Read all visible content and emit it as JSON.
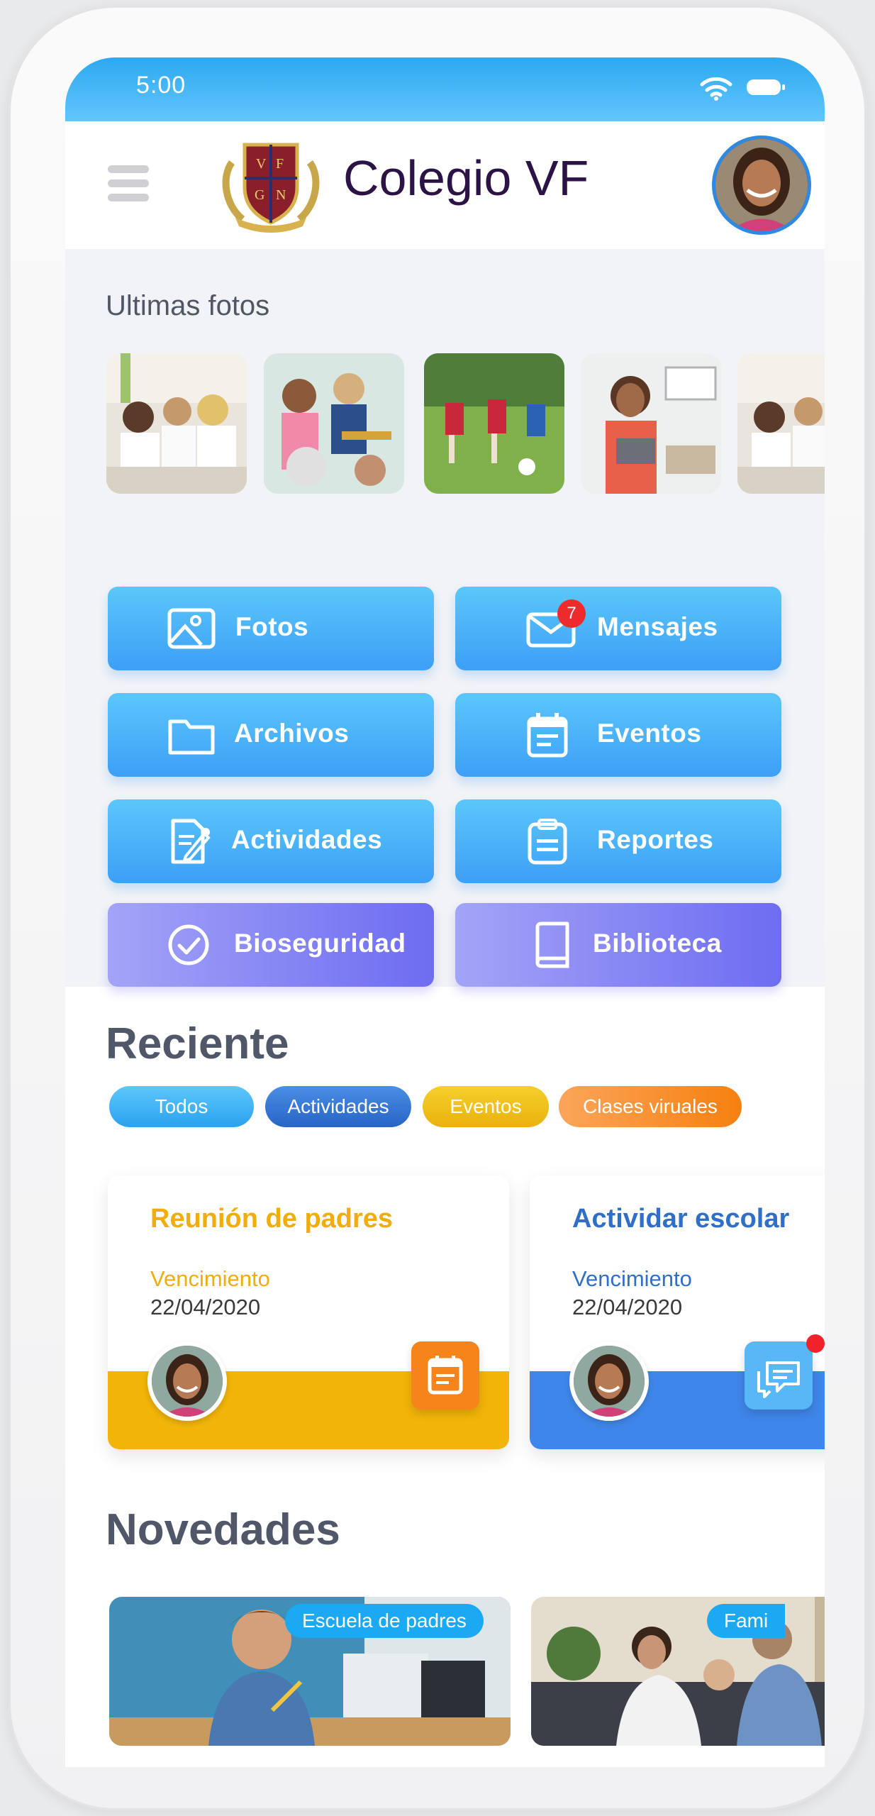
{
  "status_bar": {
    "time": "5:00"
  },
  "header": {
    "title": "Colegio VF",
    "crest_letters": [
      "V",
      "F",
      "G",
      "N"
    ]
  },
  "photos": {
    "title": "Ultimas fotos"
  },
  "tiles": [
    {
      "label": "Fotos",
      "icon": "image-icon"
    },
    {
      "label": "Mensajes",
      "icon": "mail-icon",
      "badge": "7"
    },
    {
      "label": "Archivos",
      "icon": "folder-icon"
    },
    {
      "label": "Eventos",
      "icon": "calendar-icon"
    },
    {
      "label": "Actividades",
      "icon": "edit-document-icon"
    },
    {
      "label": "Reportes",
      "icon": "clipboard-icon"
    },
    {
      "label": "Bioseguridad",
      "icon": "check-circle-icon"
    },
    {
      "label": "Biblioteca",
      "icon": "book-icon"
    }
  ],
  "recent": {
    "title": "Reciente",
    "chips": [
      "Todos",
      "Actividades",
      "Eventos",
      "Clases viruales"
    ],
    "cards": [
      {
        "title": "Reunión de padres",
        "label": "Vencimiento",
        "date": "22/04/2020",
        "color": "#f2b409",
        "icon": "calendar-icon"
      },
      {
        "title": "Actividar escolar",
        "label": "Vencimiento",
        "date": "22/04/2020",
        "color": "#3f86ea",
        "icon": "chat-icon"
      }
    ]
  },
  "news": {
    "title": "Novedades",
    "items": [
      {
        "tag": "Escuela de padres"
      },
      {
        "tag": "Fami"
      }
    ]
  },
  "colors": {
    "primary": "#3d9ff6",
    "purple": "#6e6cf1",
    "yellow": "#f2b409",
    "orange": "#f7841b",
    "dark_title": "#2b1345"
  }
}
